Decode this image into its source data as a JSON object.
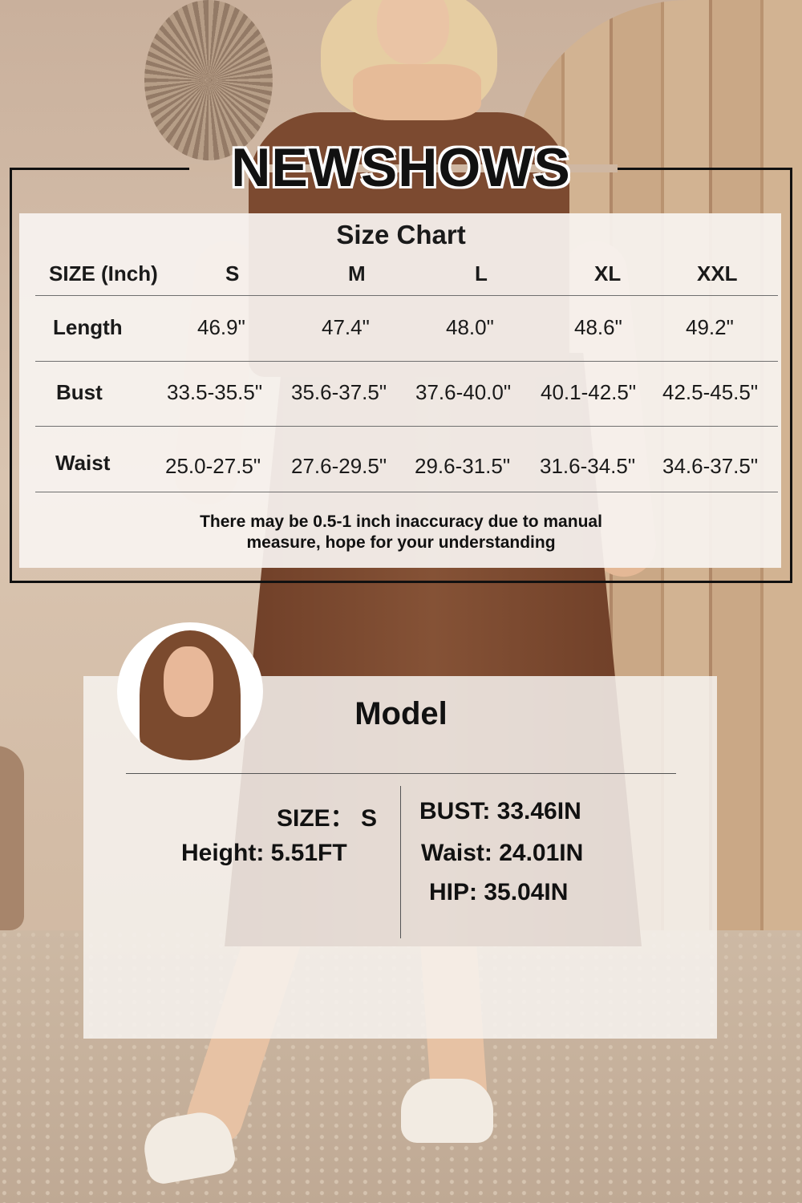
{
  "brand": "NEWSHOWS",
  "size_chart": {
    "title": "Size Chart",
    "header": [
      "SIZE (Inch)",
      "S",
      "M",
      "L",
      "XL",
      "XXL"
    ],
    "rows": [
      {
        "label": "Length",
        "values": [
          "46.9\"",
          "47.4\"",
          "48.0\"",
          "48.6\"",
          "49.2\""
        ]
      },
      {
        "label": "Bust",
        "values": [
          "33.5-35.5\"",
          "35.6-37.5\"",
          "37.6-40.0\"",
          "40.1-42.5\"",
          "42.5-45.5\""
        ]
      },
      {
        "label": "Waist",
        "values": [
          "25.0-27.5\"",
          "27.6-29.5\"",
          "29.6-31.5\"",
          "31.6-34.5\"",
          "34.6-37.5\""
        ]
      }
    ],
    "note_line1": "There may be 0.5-1 inch inaccuracy due to manual",
    "note_line2": "measure, hope for your understanding"
  },
  "model": {
    "title": "Model",
    "size": "SIZE： S",
    "height": "Height:  5.51FT",
    "bust": "BUST: 33.46IN",
    "waist": "Waist: 24.01IN",
    "hip": "HIP: 35.04IN"
  }
}
